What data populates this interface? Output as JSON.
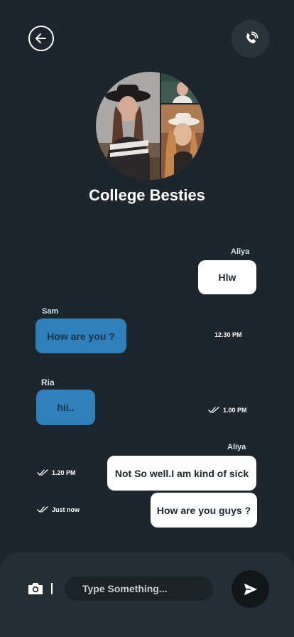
{
  "header": {
    "back_icon": "back-arrow-icon",
    "call_icon": "phone-call-icon"
  },
  "group": {
    "title": "College Besties"
  },
  "messages": [
    {
      "sender": "Aliya",
      "text": "Hlw",
      "side": "right"
    },
    {
      "sender": "Sam",
      "text": "How are you ?",
      "time": "12.30 PM",
      "side": "left"
    },
    {
      "sender": "Ria",
      "text": "hii..",
      "time": "1.00 PM",
      "side": "left",
      "read": true
    },
    {
      "sender": "Aliya",
      "text": "Not So well.I am kind of sick",
      "time": "1.20 PM",
      "side": "right",
      "read": true
    },
    {
      "text": "How are you guys ?",
      "time": "Just now",
      "side": "right",
      "read": true
    }
  ],
  "composer": {
    "placeholder": "Type Something...",
    "camera_icon": "camera-icon",
    "send_icon": "send-icon"
  },
  "colors": {
    "background": "#1d262d",
    "bubble_blue": "#2f7fba",
    "bubble_white": "#ffffff",
    "footer": "#242e35"
  }
}
